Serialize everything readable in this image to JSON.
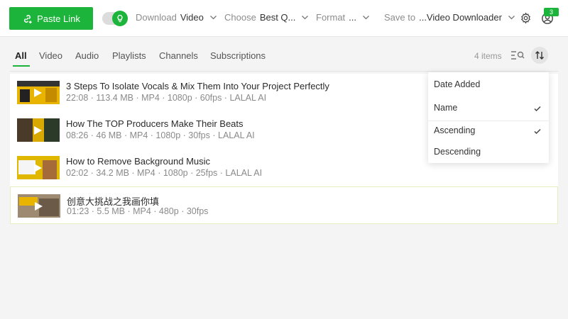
{
  "toolbar": {
    "paste_label": "Paste Link",
    "download": {
      "label": "Download",
      "value": "Video"
    },
    "choose": {
      "label": "Choose",
      "value": "Best Q..."
    },
    "format": {
      "label": "Format",
      "value": "..."
    },
    "save_to": {
      "label": "Save to",
      "value": "...Video Downloader"
    },
    "badge_count": "3"
  },
  "tabs": [
    "All",
    "Video",
    "Audio",
    "Playlists",
    "Channels",
    "Subscriptions"
  ],
  "active_tab": "All",
  "items_count": "4 items",
  "items": [
    {
      "title": "3 Steps To Isolate Vocals & Mix Them Into Your Project Perfectly",
      "meta": "22:08 · 113.4 MB · MP4 · 1080p · 60fps · LALAL AI"
    },
    {
      "title": "How The TOP Producers Make Their Beats",
      "meta": "08:26 · 46 MB · MP4 · 1080p · 30fps · LALAL AI"
    },
    {
      "title": "How to Remove Background Music",
      "meta": "02:02 · 34.2 MB · MP4 · 1080p · 25fps · LALAL AI"
    },
    {
      "title": "创意大挑战之我画你填",
      "meta": "01:23 · 5.5 MB · MP4 · 480p · 30fps"
    }
  ],
  "sort_menu": {
    "sort_by": [
      {
        "label": "Date Added",
        "checked": false
      },
      {
        "label": "Name",
        "checked": true
      }
    ],
    "order": [
      {
        "label": "Ascending",
        "checked": true
      },
      {
        "label": "Descending",
        "checked": false
      }
    ]
  },
  "colors": {
    "accent": "#1cb43a",
    "background": "#f4f4f4"
  }
}
